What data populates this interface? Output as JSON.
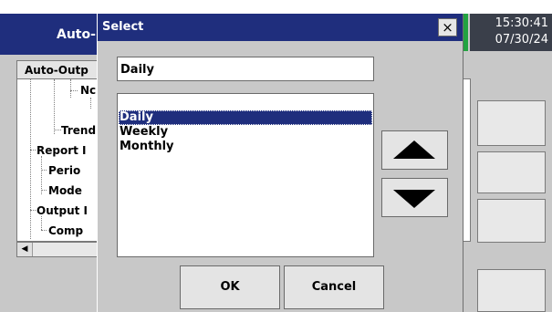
{
  "background_window": {
    "title": "Auto-",
    "tab_label": "Auto-Outp",
    "tree_items": [
      "Nc",
      "Trend",
      "Report I",
      "Perio",
      "Mode",
      "Output I",
      "Comp"
    ]
  },
  "clock": {
    "time": "15:30:41",
    "date": "07/30/24"
  },
  "dialog": {
    "title": "Select",
    "close_glyph": "×",
    "current_value": "Daily",
    "options": [
      "Daily",
      "Weekly",
      "Monthly"
    ],
    "selected_index": 0,
    "ok_label": "OK",
    "cancel_label": "Cancel"
  },
  "icons": {
    "close": "close-icon",
    "up": "arrow-up-icon",
    "down": "arrow-down-icon",
    "scroll_left": "scroll-left-icon"
  },
  "colors": {
    "titlebar": "#1f2e7d",
    "selection": "#1f2e7d",
    "panel": "#c8c8c8",
    "clock_bg": "#3a3f4a",
    "status_red": "#cc2222",
    "status_green": "#23a341"
  }
}
